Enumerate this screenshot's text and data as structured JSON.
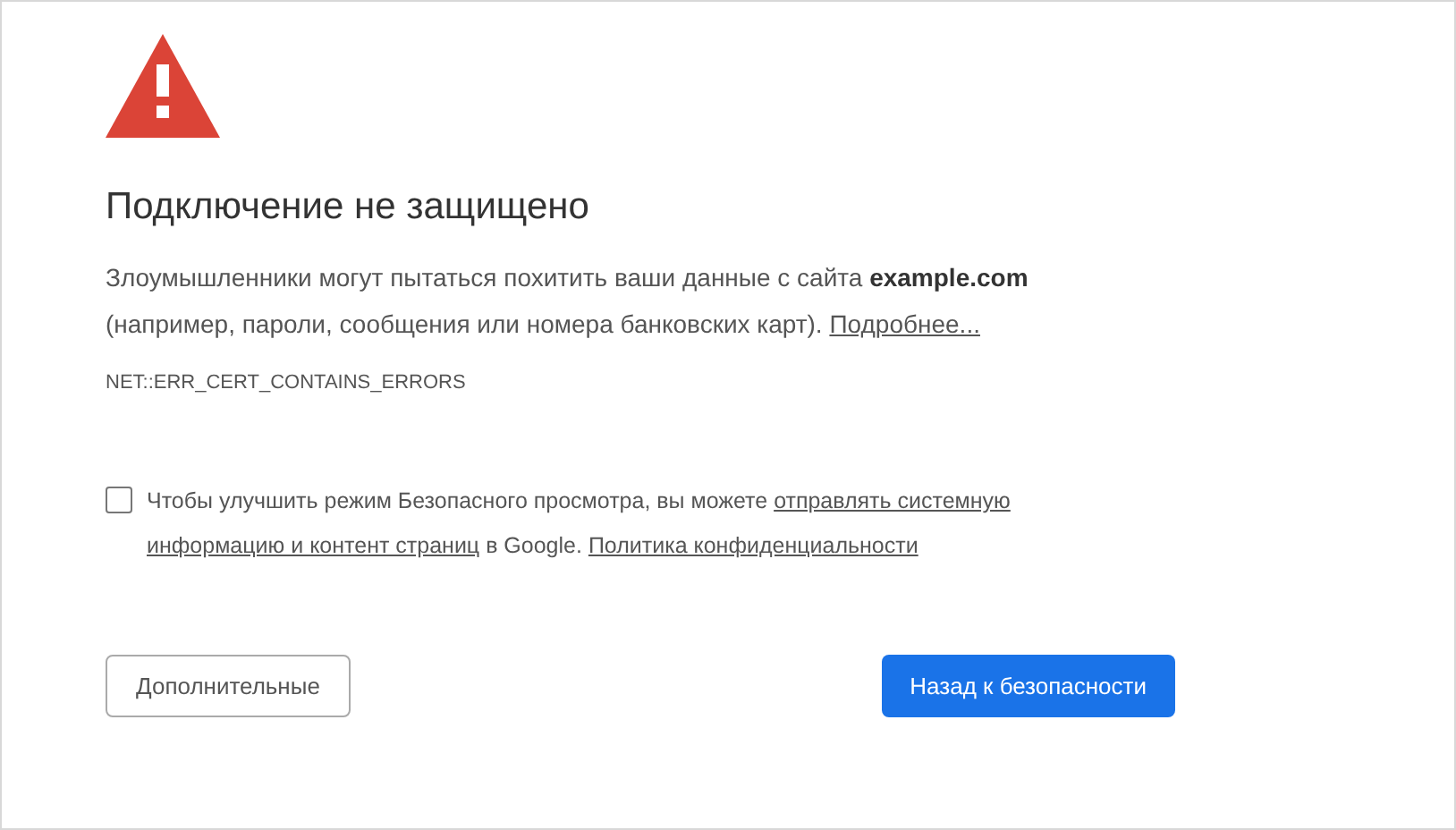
{
  "title": "Подключение не защищено",
  "description": {
    "text": "Злоумышленники могут пытаться похитить ваши данные с сайта **example.com** (например, пароли, сообщения или номера банковских карт). ",
    "link": "Подробнее..."
  },
  "error_code": "NET::ERR_CERT_CONTAINS_ERRORS",
  "report": {
    "checked": false,
    "text_before": "Чтобы улучшить режим Безопасного просмотра, вы можете ",
    "link_parts": [
      "отправлять системную",
      "информацию и контент страниц"
    ],
    "text_middle": " в Google. ",
    "policy_link": "Политика конфиденциальности"
  },
  "buttons": [
    {
      "kind": "secondary",
      "label": "Дополнительные"
    },
    {
      "kind": "primary",
      "label": "Назад к безопасности"
    }
  ]
}
